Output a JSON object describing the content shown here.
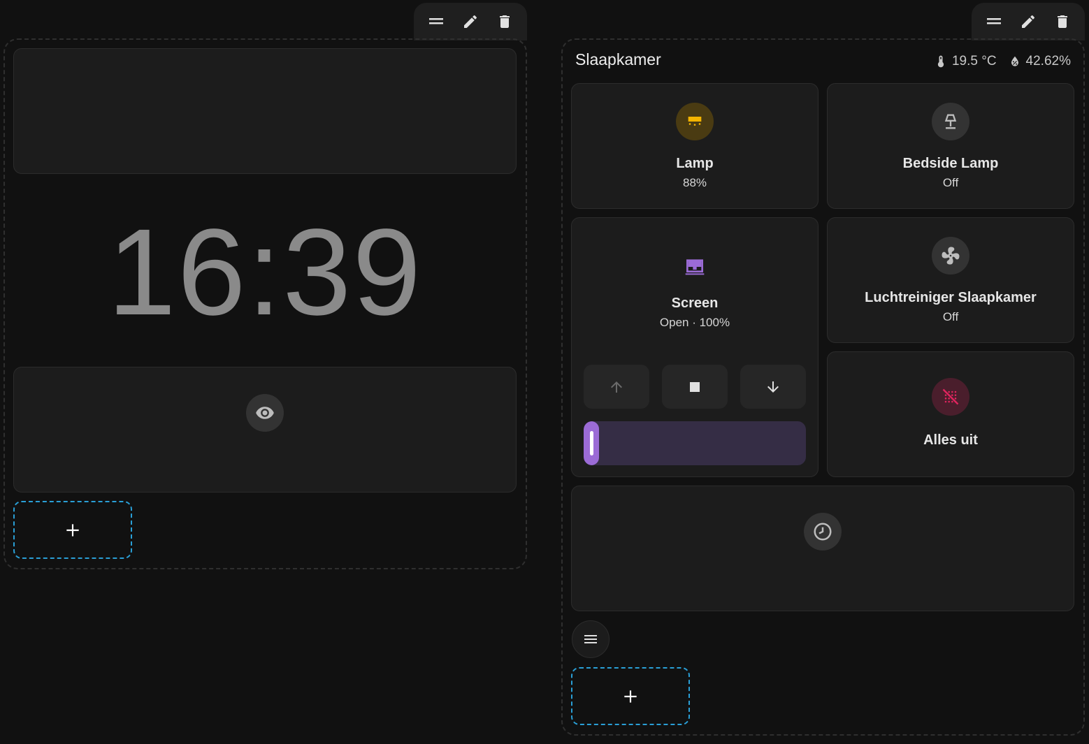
{
  "colors": {
    "background": "#111111",
    "card": "#1c1c1c",
    "accent_blue": "#2a9fd6",
    "lamp_on": "#f4b400",
    "cover_purple": "#9b6bd6",
    "alert_pink": "#e0245e"
  },
  "left_section": {
    "toolbar": {
      "icons": [
        "drag-handle-icon",
        "pencil-icon",
        "trash-icon"
      ]
    },
    "clock": {
      "time": "16:39"
    },
    "hidden_card": {
      "icon": "eye-icon"
    },
    "add_button": {
      "icon": "plus-icon"
    }
  },
  "right_section": {
    "toolbar": {
      "icons": [
        "drag-handle-icon",
        "pencil-icon",
        "trash-icon"
      ]
    },
    "area": {
      "title": "Slaapkamer",
      "temperature": "19.5 °C",
      "humidity": "42.62%"
    },
    "tiles": {
      "lamp": {
        "name": "Lamp",
        "state": "88%",
        "icon": "ceiling-light-icon"
      },
      "bedside_lamp": {
        "name": "Bedside Lamp",
        "state": "Off",
        "icon": "lamp-icon"
      },
      "screen": {
        "name": "Screen",
        "state": "Open · 100%",
        "icon": "window-shutter-icon",
        "position_fraction": 1.0,
        "controls": [
          "arrow-up-icon",
          "stop-icon",
          "arrow-down-icon"
        ]
      },
      "air_purifier": {
        "name": "Luchtreiniger Slaapkamer",
        "state": "Off",
        "icon": "fan-icon"
      },
      "all_off": {
        "name": "Alles uit",
        "icon": "lightbulb-off-icon"
      }
    },
    "history_card": {
      "icon": "clock-icon"
    },
    "menu_button": {
      "icon": "menu-icon"
    },
    "add_button": {
      "icon": "plus-icon"
    }
  }
}
